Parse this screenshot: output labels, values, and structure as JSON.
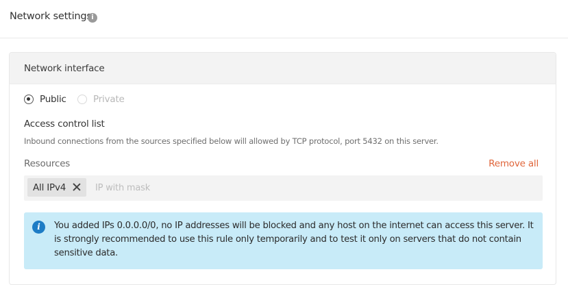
{
  "header": {
    "title": "Network settings",
    "info_icon": "i"
  },
  "network_interface": {
    "title": "Network interface",
    "options": [
      {
        "label": "Public",
        "selected": true,
        "disabled": false
      },
      {
        "label": "Private",
        "selected": false,
        "disabled": true
      }
    ]
  },
  "acl": {
    "title": "Access control list",
    "description": "Inbound connections from the sources specified below will allowed by TCP protocol, port 5432 on this server."
  },
  "resources": {
    "label": "Resources",
    "remove_all_label": "Remove all",
    "tags": [
      "All IPv4"
    ],
    "input_placeholder": "IP with mask",
    "input_value": ""
  },
  "alert": {
    "icon": "i",
    "text": "You added IPs 0.0.0.0/0, no IP addresses will be blocked and any host on the internet can access this server. It is strongly recommended to use this rule only temporarily and to test it only on servers that do not contain sensitive data."
  },
  "colors": {
    "accent_link": "#e0653a",
    "alert_background": "#c8ebf8",
    "alert_icon": "#1d7cc5"
  }
}
